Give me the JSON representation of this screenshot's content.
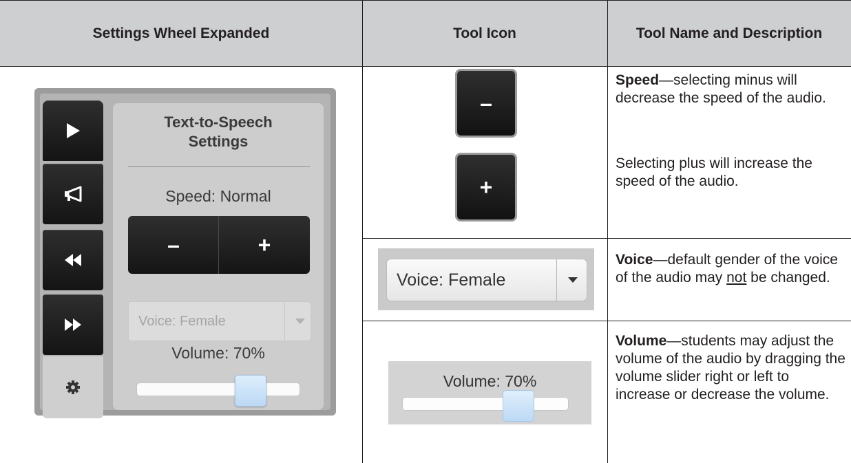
{
  "header": {
    "col1": "Settings Wheel Expanded",
    "col2": "Tool Icon",
    "col3": "Tool Name and Description"
  },
  "wheel": {
    "panel_title": "Text-to-Speech Settings",
    "speed_label": "Speed: Normal",
    "minus": "–",
    "plus": "+",
    "voice_label": "Voice: Female",
    "volume_label": "Volume: 70%",
    "volume_level": 0.7,
    "buttons": [
      "play-icon",
      "megaphone-icon",
      "rewind-icon",
      "fast-forward-icon",
      "gear-icon"
    ]
  },
  "tools": {
    "speed": {
      "minus_icon": "–",
      "plus_icon": "+",
      "name": "Speed",
      "desc1": "—selecting minus will decrease the speed of the audio.",
      "desc2": "Selecting plus will increase the speed of the audio."
    },
    "voice": {
      "icon_label": "Voice: Female",
      "name": "Voice",
      "desc_a": "—default gender of the voice of the audio may ",
      "desc_not": "not",
      "desc_b": " be changed."
    },
    "volume": {
      "icon_label": "Volume: 70%",
      "volume_level": 0.7,
      "name": "Volume",
      "desc": "—students may adjust the volume of the audio by dragging the volume slider right or left to increase or decrease the volume."
    }
  },
  "colors": {
    "header_bg": "#cecfd1",
    "rule": "#231f20",
    "button_dark": "#1c1c1c",
    "slider_thumb": "#bcd9f5"
  }
}
